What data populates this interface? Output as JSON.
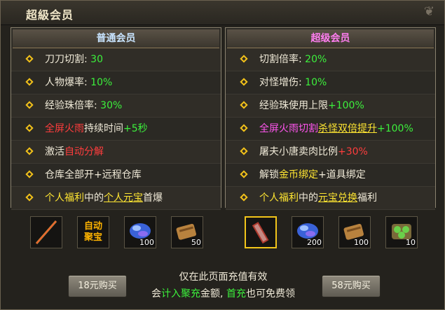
{
  "title": "超級会员",
  "left_panel": {
    "header": "普通会员",
    "rows": [
      {
        "parts": [
          {
            "t": "刀刀切割: ",
            "c": "w"
          },
          {
            "t": "30",
            "c": "g"
          }
        ]
      },
      {
        "parts": [
          {
            "t": "人物爆率: ",
            "c": "w"
          },
          {
            "t": "10%",
            "c": "g"
          }
        ]
      },
      {
        "parts": [
          {
            "t": "经验珠倍率: ",
            "c": "w"
          },
          {
            "t": "30%",
            "c": "g"
          }
        ]
      },
      {
        "parts": [
          {
            "t": "全屏火雨",
            "c": "r"
          },
          {
            "t": "持续时间",
            "c": "w"
          },
          {
            "t": "+5秒",
            "c": "g"
          }
        ]
      },
      {
        "parts": [
          {
            "t": "激活",
            "c": "w"
          },
          {
            "t": "自动分解",
            "c": "r"
          }
        ]
      },
      {
        "parts": [
          {
            "t": "仓库全部开+远程仓库",
            "c": "w"
          }
        ]
      },
      {
        "parts": [
          {
            "t": "个人福利",
            "c": "y"
          },
          {
            "t": "中的",
            "c": "w"
          },
          {
            "t": "个人元宝",
            "c": "y u"
          },
          {
            "t": "首爆",
            "c": "w"
          }
        ]
      }
    ],
    "items": [
      {
        "name": "weapon-staff-icon",
        "qty": ""
      },
      {
        "name": "auto-gather-treasure",
        "label": "自动\n聚宝",
        "qty": ""
      },
      {
        "name": "blue-gem-icon",
        "qty": "100"
      },
      {
        "name": "brown-scroll-icon",
        "qty": "50"
      }
    ]
  },
  "right_panel": {
    "header": "超级会员",
    "rows": [
      {
        "parts": [
          {
            "t": "切割倍率: ",
            "c": "w"
          },
          {
            "t": "20%",
            "c": "g"
          }
        ]
      },
      {
        "parts": [
          {
            "t": "对怪增伤: ",
            "c": "w"
          },
          {
            "t": "10%",
            "c": "g"
          }
        ]
      },
      {
        "parts": [
          {
            "t": "经验珠使用上限",
            "c": "w"
          },
          {
            "t": "+100%",
            "c": "g"
          }
        ]
      },
      {
        "parts": [
          {
            "t": "全屏火雨切割",
            "c": "p"
          },
          {
            "t": "杀怪双倍提升",
            "c": "y u"
          },
          {
            "t": "+100%",
            "c": "g"
          }
        ]
      },
      {
        "parts": [
          {
            "t": "屠夫小唐卖肉比例",
            "c": "w"
          },
          {
            "t": "+30%",
            "c": "r"
          }
        ]
      },
      {
        "parts": [
          {
            "t": "解锁",
            "c": "w"
          },
          {
            "t": "金币绑定",
            "c": "y"
          },
          {
            "t": "+道具绑定",
            "c": "w"
          }
        ]
      },
      {
        "parts": [
          {
            "t": "个人福利",
            "c": "y"
          },
          {
            "t": "中的",
            "c": "w"
          },
          {
            "t": "元宝兑换",
            "c": "y u"
          },
          {
            "t": "福利",
            "c": "w"
          }
        ]
      }
    ],
    "items": [
      {
        "name": "red-cannon-icon",
        "qty": "",
        "selected": true
      },
      {
        "name": "blue-gem-icon",
        "qty": "200"
      },
      {
        "name": "brown-scroll-icon",
        "qty": "100"
      },
      {
        "name": "green-orb-pack-icon",
        "qty": "10"
      }
    ]
  },
  "footer": {
    "note_line1": "仅在此页面充值有效",
    "note_line2_parts": [
      {
        "t": "会",
        "c": ""
      },
      {
        "t": "计入聚充",
        "c": "g"
      },
      {
        "t": "金额, ",
        "c": ""
      },
      {
        "t": "首充",
        "c": "g"
      },
      {
        "t": "也可免费领",
        "c": ""
      }
    ],
    "btn_left": "18元购买",
    "btn_right": "58元购买"
  }
}
